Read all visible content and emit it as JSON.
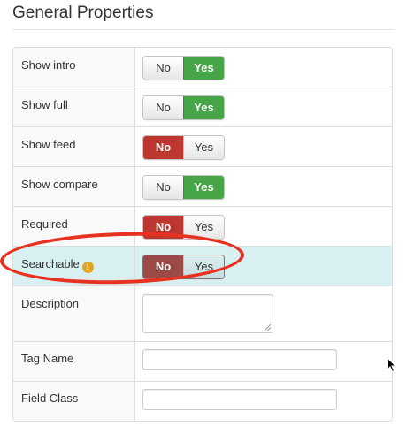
{
  "heading": "General Properties",
  "rows": [
    {
      "label": "Show intro",
      "no": "No",
      "yes": "Yes",
      "selected": "yes"
    },
    {
      "label": "Show full",
      "no": "No",
      "yes": "Yes",
      "selected": "yes"
    },
    {
      "label": "Show feed",
      "no": "No",
      "yes": "Yes",
      "selected": "no"
    },
    {
      "label": "Show compare",
      "no": "No",
      "yes": "Yes",
      "selected": "yes"
    },
    {
      "label": "Required",
      "no": "No",
      "yes": "Yes",
      "selected": "no"
    },
    {
      "label": "Searchable",
      "no": "No",
      "yes": "Yes",
      "selected": "no",
      "icon": "warning-icon"
    }
  ],
  "description": {
    "label": "Description",
    "value": ""
  },
  "tag_name": {
    "label": "Tag Name",
    "value": ""
  },
  "field_class": {
    "label": "Field Class",
    "value": ""
  },
  "warning_glyph": "!",
  "colors": {
    "yes_active": "#46a546",
    "no_active": "#bd362f",
    "highlight_row": "#d9f0f2",
    "annotation": "#e8321f"
  }
}
